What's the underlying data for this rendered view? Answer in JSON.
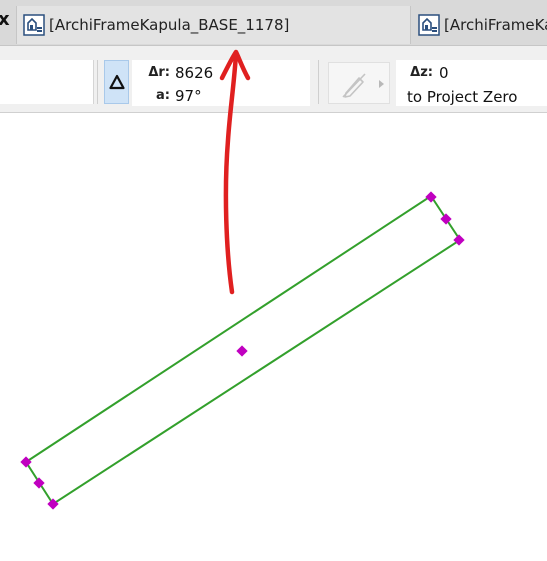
{
  "tabs": [
    {
      "label": "[ArchiFrameKapula_BASE_1178]",
      "active": true,
      "icon": "archicad-view-icon"
    },
    {
      "label": "[ArchiFrameKapula",
      "active": false,
      "icon": "archicad-view-icon"
    }
  ],
  "tab_close_glyph": "x",
  "tracker": {
    "dr_label": "Δr:",
    "dr_value": "8626",
    "a_label": "a:",
    "a_value": "97°",
    "dz_label": "Δz:",
    "dz_value": "0",
    "reference": "to Project Zero"
  },
  "colors": {
    "outline": "#33a02c",
    "node": "#c000c0",
    "annotation": "#e02020",
    "delta_active_bg": "#cfe3f7"
  },
  "icons": {
    "delta": "delta-icon",
    "pen_disabled": "pen-disabled-icon",
    "dropdown": "triangle-right-icon"
  }
}
